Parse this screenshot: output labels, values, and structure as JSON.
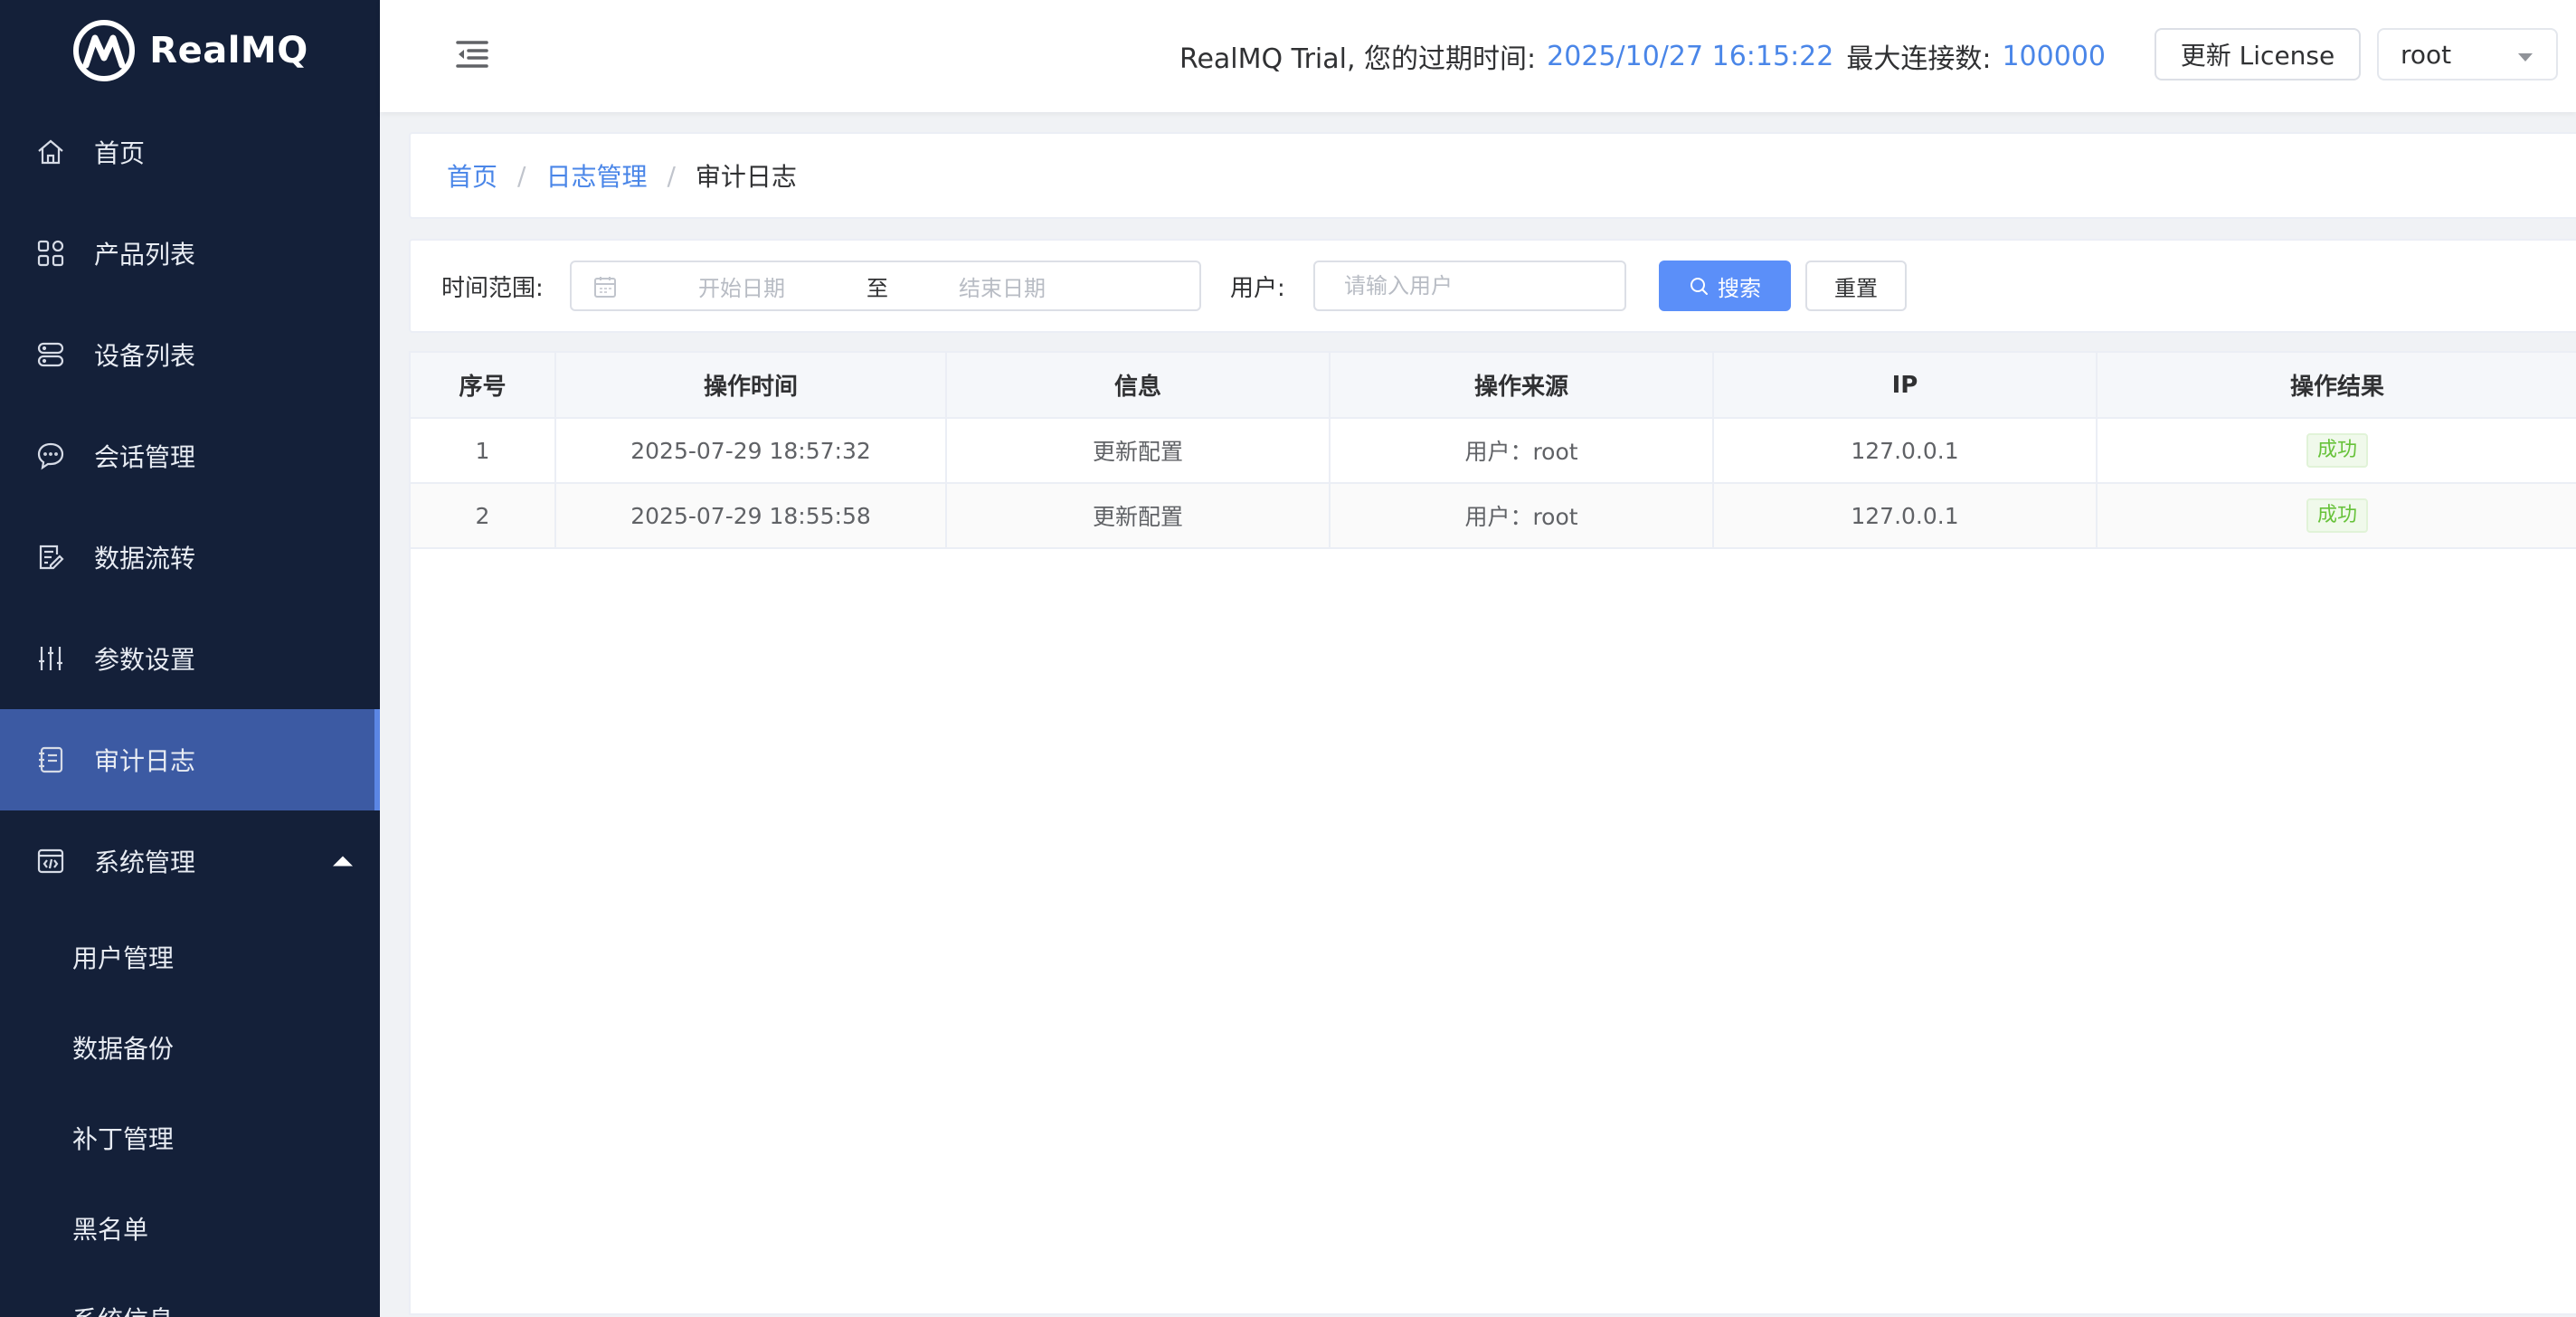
{
  "app": {
    "logo_text": "RealMQ"
  },
  "sidebar": {
    "items": [
      {
        "label": "首页",
        "icon": "home-icon"
      },
      {
        "label": "产品列表",
        "icon": "grid-icon"
      },
      {
        "label": "设备列表",
        "icon": "server-icon"
      },
      {
        "label": "会话管理",
        "icon": "chat-icon"
      },
      {
        "label": "数据流转",
        "icon": "edit-doc-icon"
      },
      {
        "label": "参数设置",
        "icon": "sliders-icon"
      },
      {
        "label": "审计日志",
        "icon": "log-icon",
        "active": true
      },
      {
        "label": "系统管理",
        "icon": "code-window-icon",
        "expanded": true
      }
    ],
    "submenu": [
      {
        "label": "用户管理"
      },
      {
        "label": "数据备份"
      },
      {
        "label": "补丁管理"
      },
      {
        "label": "黑名单"
      },
      {
        "label": "系统信息"
      }
    ]
  },
  "header": {
    "trial_text": "RealMQ Trial, 您的过期时间:",
    "expire_time": "2025/10/27 16:15:22",
    "max_conn_label": "最大连接数:",
    "max_conn_value": "100000",
    "license_button": "更新 License",
    "user": "root"
  },
  "breadcrumb": {
    "items": [
      "首页",
      "日志管理"
    ],
    "current": "审计日志"
  },
  "filter": {
    "time_label": "时间范围:",
    "start_placeholder": "开始日期",
    "range_separator": "至",
    "end_placeholder": "结束日期",
    "user_label": "用户:",
    "user_placeholder": "请输入用户",
    "search_button": "搜索",
    "reset_button": "重置"
  },
  "table": {
    "columns": [
      "序号",
      "操作时间",
      "信息",
      "操作来源",
      "IP",
      "操作结果"
    ],
    "rows": [
      {
        "index": "1",
        "time": "2025-07-29 18:57:32",
        "info": "更新配置",
        "source": "用户：root",
        "ip": "127.0.0.1",
        "result": "成功"
      },
      {
        "index": "2",
        "time": "2025-07-29 18:55:58",
        "info": "更新配置",
        "source": "用户：root",
        "ip": "127.0.0.1",
        "result": "成功"
      }
    ]
  },
  "colors": {
    "sidebar_bg": "#142039",
    "active_item": "#3c5aa3",
    "accent": "#4a86e8",
    "search_button": "#5b8ff9",
    "success": "#67c23a"
  }
}
